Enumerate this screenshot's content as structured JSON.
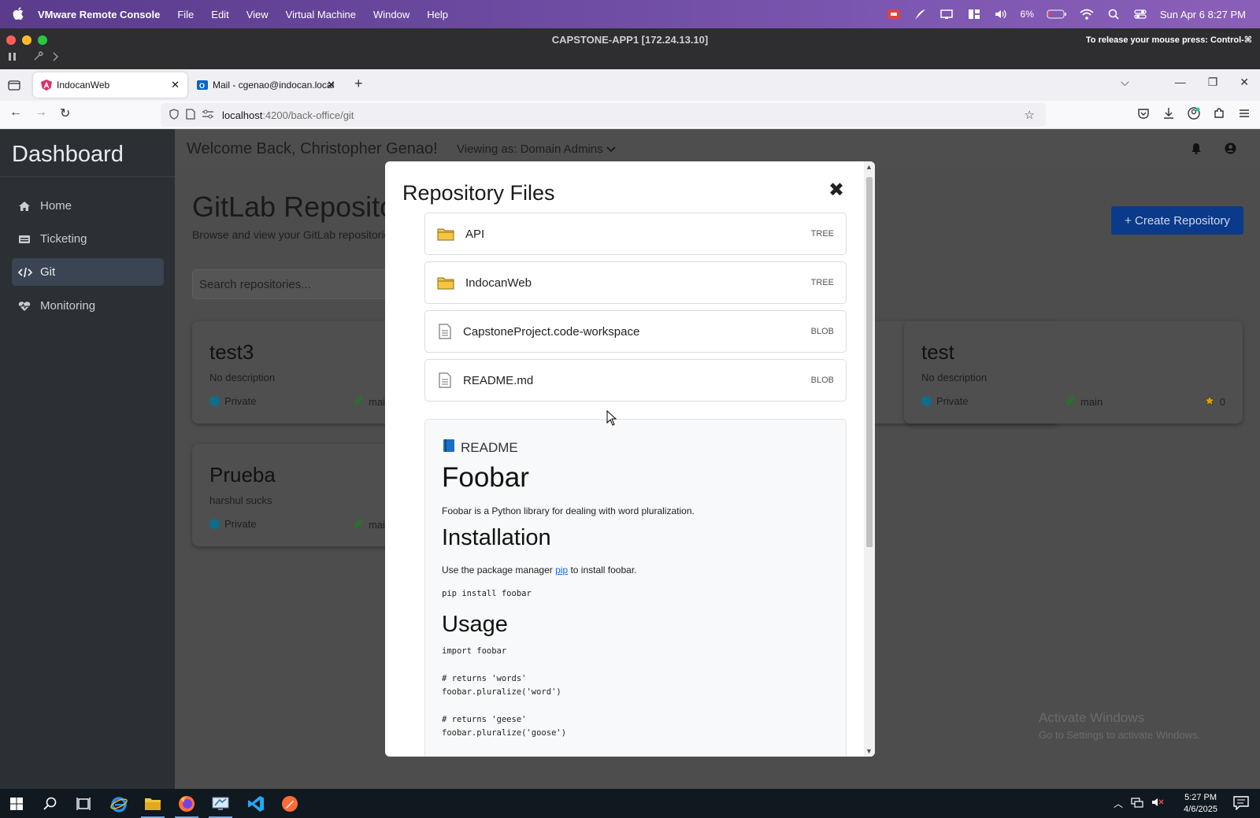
{
  "mac_menubar": {
    "app_name": "VMware Remote Console",
    "menus": [
      "File",
      "Edit",
      "View",
      "Virtual Machine",
      "Window",
      "Help"
    ],
    "battery": "6%",
    "datetime": "Sun Apr 6  8:27 PM"
  },
  "vmware": {
    "window_title": "CAPSTONE-APP1 [172.24.13.10]",
    "release_hint": "To release your mouse press: Control-⌘"
  },
  "browser": {
    "tabs": [
      {
        "label": "IndocanWeb"
      },
      {
        "label": "Mail - cgenao@indocan.local"
      }
    ],
    "url_host": "localhost",
    "url_path": ":4200/back-office/git"
  },
  "sidebar": {
    "brand": "Dashboard",
    "items": [
      {
        "label": "Home",
        "icon": "home-icon"
      },
      {
        "label": "Ticketing",
        "icon": "ticket-icon"
      },
      {
        "label": "Git",
        "icon": "code-icon"
      },
      {
        "label": "Monitoring",
        "icon": "heart-pulse-icon"
      }
    ]
  },
  "header": {
    "welcome": "Welcome Back, Christopher Genao!",
    "viewing_as": "Viewing as: Domain Admins"
  },
  "page": {
    "title": "GitLab Repositories",
    "subtitle": "Browse and view your GitLab repositories",
    "create_button": "+ Create Repository",
    "search_placeholder": "Search repositories..."
  },
  "repos": [
    {
      "name": "test3",
      "description": "No description",
      "visibility": "Private",
      "branch": "main"
    },
    {
      "name": "test",
      "description": "No description",
      "visibility": "Private",
      "branch": "main",
      "stars": "0"
    },
    {
      "name": "Prueba",
      "description": "harshul sucks",
      "visibility": "Private",
      "branch": "main"
    }
  ],
  "watermark": {
    "line1": "Activate Windows",
    "line2": "Go to Settings to activate Windows."
  },
  "modal": {
    "title": "Repository Files",
    "files": [
      {
        "name": "API",
        "type": "TREE"
      },
      {
        "name": "IndocanWeb",
        "type": "TREE"
      },
      {
        "name": "CapstoneProject.code-workspace",
        "type": "BLOB"
      },
      {
        "name": "README.md",
        "type": "BLOB"
      }
    ],
    "readme": {
      "header": "README",
      "h1": "Foobar",
      "intro": "Foobar is a Python library for dealing with word pluralization.",
      "installation_heading": "Installation",
      "install_text_before": "Use the package manager ",
      "install_link": "pip",
      "install_text_after": " to install foobar.",
      "install_cmd": "pip install foobar",
      "usage_heading": "Usage",
      "code_lines": [
        "import foobar",
        "",
        "# returns 'words'",
        "foobar.pluralize('word')",
        "",
        "# returns 'geese'",
        "foobar.pluralize('goose')"
      ]
    }
  },
  "taskbar": {
    "time": "5:27 PM",
    "date": "4/6/2025"
  }
}
